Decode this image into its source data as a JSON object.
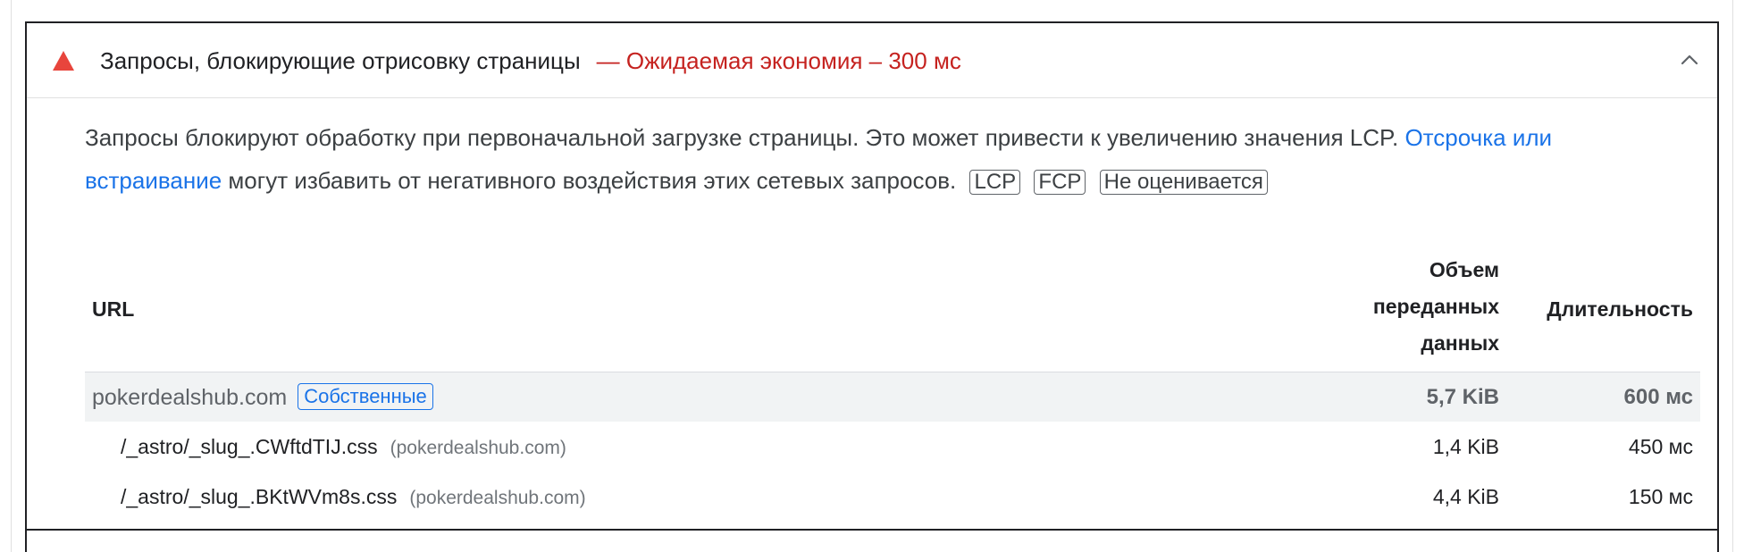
{
  "audit": {
    "title": "Запросы, блокирующие отрисовку страницы",
    "separator": "—",
    "savings": "Ожидаемая экономия – 300 мс",
    "status_color": "#e8453c",
    "description_part1": "Запросы блокируют обработку при первоначальной загрузке страницы. Это может привести к увеличению значения LCP. ",
    "description_link": "Отсрочка или встраивание",
    "description_part2": " могут избавить от негативного воздействия этих сетевых запросов.",
    "tags": [
      "LCP",
      "FCP",
      "Не оценивается"
    ]
  },
  "table": {
    "headers": {
      "url": "URL",
      "size_line1": "Объем",
      "size_line2": "переданных",
      "size_line3": "данных",
      "duration": "Длительность"
    },
    "group": {
      "name": "pokerdealshub.com",
      "badge": "Собственные",
      "size": "5,7 KiB",
      "duration": "600 мс"
    },
    "rows": [
      {
        "url": "/_astro/_slug_.CWftdTIJ.css",
        "host": "(pokerdealshub.com)",
        "size": "1,4 KiB",
        "duration": "450 мс"
      },
      {
        "url": "/_astro/_slug_.BKtWVm8s.css",
        "host": "(pokerdealshub.com)",
        "size": "4,4 KiB",
        "duration": "150 мс"
      }
    ]
  }
}
